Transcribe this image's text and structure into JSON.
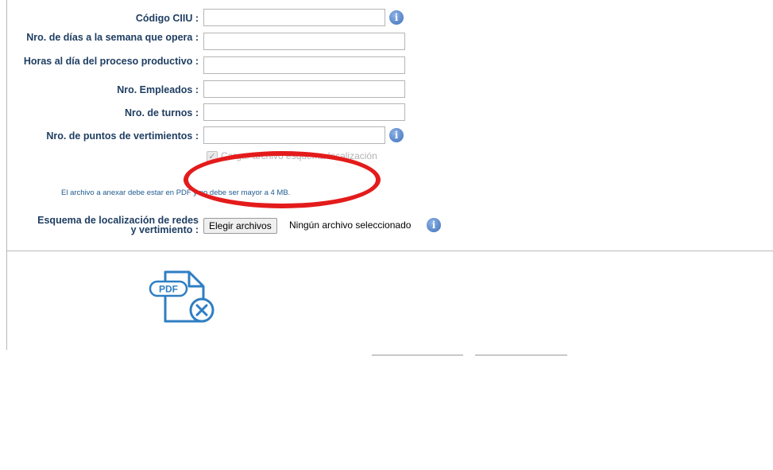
{
  "form": {
    "fields": [
      {
        "label": "Código CIIU :",
        "value": "",
        "has_info": true
      },
      {
        "label": "Nro. de días a la semana que opera :",
        "value": "",
        "has_info": false
      },
      {
        "label": "Horas al día del proceso productivo :",
        "value": "",
        "has_info": false
      },
      {
        "label": "Nro. Empleados :",
        "value": "",
        "has_info": false
      },
      {
        "label": "Nro. de turnos :",
        "value": "",
        "has_info": false
      },
      {
        "label": "Nro. de puntos de vertimientos :",
        "value": "",
        "has_info": true
      }
    ],
    "checkbox_label": "Cargar archivo esquema localización",
    "checkbox_checked": true,
    "note": "El archivo a anexar debe estar en PDF y no debe ser mayor a 4 MB.",
    "file_label_line1": "Esquema de localización de redes",
    "file_label_line2": "y vertimiento :",
    "file_button": "Elegir archivos",
    "file_status": "Ningún archivo seleccionado"
  },
  "icons": {
    "info": "info-icon",
    "pdf": "pdf-remove-icon"
  },
  "pdf_icon_text": "PDF",
  "colors": {
    "label": "#1f3e62",
    "note": "#1f5a8f",
    "info": "#3c6fb8",
    "pdf_icon": "#2f7ec3",
    "annotation": "#e41b1b"
  }
}
